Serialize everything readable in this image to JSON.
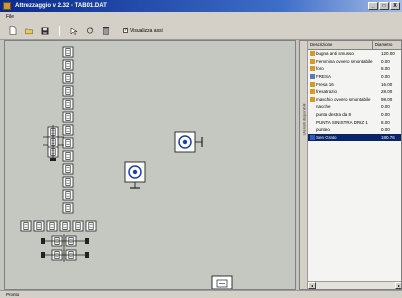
{
  "window": {
    "title": "Attrezzaggio v 2.32 - TAB01.DAT",
    "buttons": [
      "_",
      "□",
      "X"
    ]
  },
  "menu": {
    "file": "File"
  },
  "toolbar": {
    "checkbox_label": "Visualizza assi",
    "checkbox_checked": true
  },
  "panel": {
    "tab_label": "Utensili disponibili",
    "headers": {
      "description": "Descrizione",
      "diameter": "Diametro"
    },
    "items": [
      {
        "name": "bugna anti smusso",
        "value": "120.00",
        "icon": "drill-icon",
        "color": "#d89a20"
      },
      {
        "name": "Femmina ovvero smontabile",
        "value": "0.00",
        "icon": "drill-icon",
        "color": "#d89a20"
      },
      {
        "name": "foro",
        "value": "8.00",
        "icon": "drill-icon",
        "color": "#d89a20"
      },
      {
        "name": "FRESA",
        "value": "0.00",
        "icon": "mill-icon",
        "color": "#5878b8"
      },
      {
        "name": "Fresa 16",
        "value": "16.00",
        "icon": "drill-icon",
        "color": "#d89a20"
      },
      {
        "name": "fresatrazio",
        "value": "28.00",
        "icon": "drill-icon",
        "color": "#d89a20"
      },
      {
        "name": "maschio ovvero smontabile",
        "value": "98.00",
        "icon": "drill-icon",
        "color": "#d89a20"
      },
      {
        "name": "nacche",
        "value": "0.00",
        "icon": "none",
        "color": ""
      },
      {
        "name": "punta destra da 8",
        "value": "0.00",
        "icon": "none",
        "color": ""
      },
      {
        "name": "PUNTA SINISTRA DRIZ 1",
        "value": "8.00",
        "icon": "none",
        "color": ""
      },
      {
        "name": "punteo",
        "value": "0.00",
        "icon": "none",
        "color": ""
      },
      {
        "name": "Sen Grato",
        "value": "180.76",
        "icon": "saw-icon",
        "color": "#3a5ab8",
        "selected": true
      }
    ]
  },
  "status": {
    "text": "Pronto"
  },
  "colors": {
    "title_start": "#0a2a8c",
    "title_end": "#a6bce6",
    "selection": "#0a246a",
    "canvas": "#c4c8c0"
  }
}
